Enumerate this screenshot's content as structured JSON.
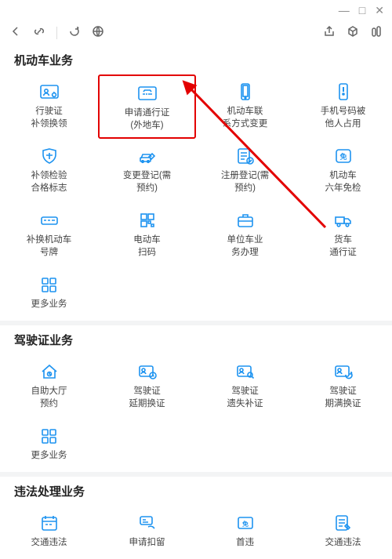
{
  "titlebar": {
    "min": "—",
    "max": "□",
    "close": "✕"
  },
  "sections": {
    "s1": "机动车业务",
    "s2": "驾驶证业务",
    "s3": "违法处理业务"
  },
  "s1": {
    "r1": [
      {
        "label": "行驶证\n补领换领"
      },
      {
        "label": "申请通行证\n(外地车)"
      },
      {
        "label": "机动车联\n系方式变更"
      },
      {
        "label": "手机号码被\n他人占用"
      }
    ],
    "r2": [
      {
        "label": "补领检验\n合格标志"
      },
      {
        "label": "变更登记(需\n预约)"
      },
      {
        "label": "注册登记(需\n预约)"
      },
      {
        "label": "机动车\n六年免检"
      }
    ],
    "r3": [
      {
        "label": "补换机动车\n号牌"
      },
      {
        "label": "电动车\n扫码"
      },
      {
        "label": "单位车业\n务办理"
      },
      {
        "label": "货车\n通行证"
      }
    ],
    "more": "更多业务"
  },
  "s2": {
    "r1": [
      {
        "label": "自助大厅\n预约"
      },
      {
        "label": "驾驶证\n延期换证"
      },
      {
        "label": "驾驶证\n遗失补证"
      },
      {
        "label": "驾驶证\n期满换证"
      }
    ],
    "more": "更多业务"
  },
  "s3": {
    "r1": [
      {
        "label": "交通违法"
      },
      {
        "label": "申请扣留"
      },
      {
        "label": "首违"
      },
      {
        "label": "交通违法"
      }
    ]
  }
}
